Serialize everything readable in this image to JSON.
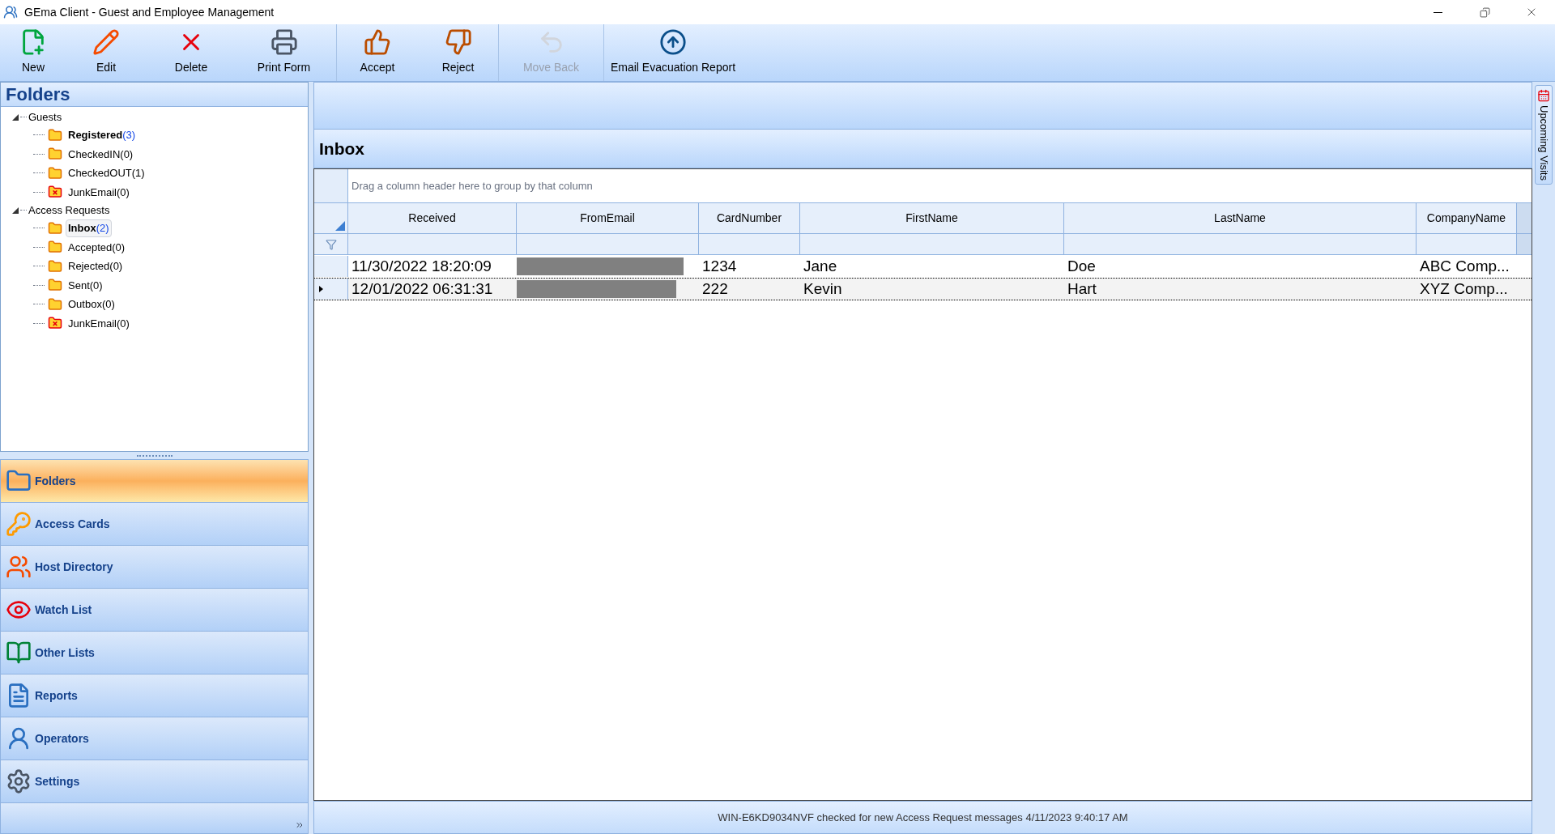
{
  "window": {
    "title": "GEma Client - Guest and Employee Management"
  },
  "toolbar": [
    {
      "label": "New",
      "disabled": false
    },
    {
      "label": "Edit",
      "disabled": false
    },
    {
      "label": "Delete",
      "disabled": false
    },
    {
      "label": "Print Form",
      "disabled": false
    },
    {
      "label": "Accept",
      "disabled": false
    },
    {
      "label": "Reject",
      "disabled": false
    },
    {
      "label": "Move Back",
      "disabled": true
    },
    {
      "label": "Email Evacuation Report",
      "disabled": false
    }
  ],
  "folders": {
    "title": "Folders",
    "tree": [
      {
        "label": "Guests",
        "expanded": true,
        "children": [
          {
            "label": "Registered",
            "count": "(3)",
            "kind": "folder",
            "bold": true,
            "selected": false
          },
          {
            "label": "CheckedIN",
            "count": "(0)",
            "kind": "folder",
            "bold": false,
            "selected": false
          },
          {
            "label": "CheckedOUT",
            "count": "(1)",
            "kind": "folder",
            "bold": false,
            "selected": false
          },
          {
            "label": "JunkEmail",
            "count": "(0)",
            "kind": "junk",
            "bold": false,
            "selected": false
          }
        ]
      },
      {
        "label": "Access Requests",
        "expanded": true,
        "children": [
          {
            "label": "Inbox",
            "count": "(2)",
            "kind": "folder",
            "bold": true,
            "selected": true
          },
          {
            "label": "Accepted",
            "count": "(0)",
            "kind": "folder",
            "bold": false,
            "selected": false
          },
          {
            "label": "Rejected",
            "count": "(0)",
            "kind": "folder",
            "bold": false,
            "selected": false
          },
          {
            "label": "Sent",
            "count": "(0)",
            "kind": "folder",
            "bold": false,
            "selected": false
          },
          {
            "label": "Outbox",
            "count": "(0)",
            "kind": "folder",
            "bold": false,
            "selected": false
          },
          {
            "label": "JunkEmail",
            "count": "(0)",
            "kind": "junk",
            "bold": false,
            "selected": false
          }
        ]
      }
    ]
  },
  "navigation": [
    {
      "label": "Folders",
      "selected": true
    },
    {
      "label": "Access Cards",
      "selected": false
    },
    {
      "label": "Host Directory",
      "selected": false
    },
    {
      "label": "Watch List",
      "selected": false
    },
    {
      "label": "Other Lists",
      "selected": false
    },
    {
      "label": "Reports",
      "selected": false
    },
    {
      "label": "Operators",
      "selected": false
    },
    {
      "label": "Settings",
      "selected": false
    }
  ],
  "inbox": {
    "title": "Inbox",
    "group_hint": "Drag a column header here to group by that column",
    "columns": [
      "Received",
      "FromEmail",
      "CardNumber",
      "FirstName",
      "LastName",
      "CompanyName"
    ],
    "rows": [
      {
        "received": "11/30/2022 18:20:09",
        "from_email_redacted": true,
        "card_number": "1234",
        "first_name": "Jane",
        "last_name": "Doe",
        "company_name": "ABC Comp...",
        "selected": false
      },
      {
        "received": "12/01/2022 06:31:31",
        "from_email_redacted": true,
        "card_number": "222",
        "first_name": "Kevin",
        "last_name": "Hart",
        "company_name": "XYZ Comp...",
        "selected": true
      }
    ]
  },
  "side_tab": {
    "label": "Upcoming Visits"
  },
  "status_bar": "WIN-E6KD9034NVF checked for new Access Request messages 4/11/2023 9:40:17 AM"
}
